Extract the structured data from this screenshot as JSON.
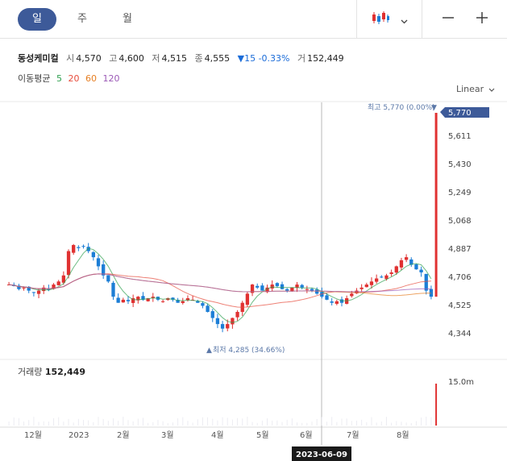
{
  "toolbar": {
    "tabs": [
      "일",
      "주",
      "월"
    ],
    "active_tab": "일"
  },
  "stock": {
    "name": "동성케미컬",
    "open_label": "시",
    "open": "4,570",
    "high_label": "고",
    "high": "4,600",
    "low_label": "저",
    "low": "4,515",
    "close_label": "종",
    "close": "4,555",
    "change_arrow": "▼",
    "change": "15",
    "change_pct": "-0.33%",
    "volume_label": "거",
    "volume": "152,449"
  },
  "moving_average": {
    "title": "이동평균",
    "periods": [
      "5",
      "20",
      "60",
      "120"
    ]
  },
  "scale": {
    "label": "Linear"
  },
  "annotations": {
    "high": "최고 5,770 (0.00%)",
    "low": "최저 4,285 (34.66%)"
  },
  "price_axis": {
    "current": "5,770",
    "ticks": [
      "5,611",
      "5,430",
      "5,249",
      "5,068",
      "4,887",
      "4,706",
      "4,525",
      "4,344"
    ]
  },
  "volume_panel": {
    "label": "거래량",
    "value": "152,449",
    "axis_label": "15.0m"
  },
  "date_axis": {
    "labels": [
      "12월",
      "2023",
      "2월",
      "3월",
      "4월",
      "5월",
      "6월",
      "7월",
      "8월"
    ],
    "crosshair_date": "2023-06-09"
  },
  "colors": {
    "up": "#e03131",
    "down": "#1c7ed6",
    "accent": "#3d5a99",
    "ma5": "#2e9f4f",
    "ma20": "#e74c3c",
    "ma60": "#e67e22",
    "ma120": "#9b59b6"
  },
  "chart_data": {
    "type": "candlestick",
    "y_range": [
      4285,
      5770
    ],
    "high": 5770,
    "low": 4285,
    "close_series": [
      4640,
      4630,
      4610,
      4620,
      4600,
      4590,
      4600,
      4620,
      4610,
      4640,
      4660,
      4700,
      4860,
      4900,
      4880,
      4890,
      4860,
      4820,
      4760,
      4700,
      4660,
      4560,
      4520,
      4540,
      4530,
      4550,
      4560,
      4540,
      4550,
      4560,
      4540,
      4530,
      4550,
      4540,
      4520,
      4530,
      4550,
      4540,
      4520,
      4500,
      4460,
      4420,
      4380,
      4350,
      4380,
      4420,
      4460,
      4520,
      4580,
      4640,
      4620,
      4600,
      4620,
      4640,
      4630,
      4610,
      4600,
      4620,
      4640,
      4620,
      4610,
      4600,
      4580,
      4560,
      4540,
      4520,
      4530,
      4520,
      4550,
      4580,
      4600,
      4620,
      4640,
      4660,
      4680,
      4690,
      4700,
      4720,
      4760,
      4800,
      4820,
      4770,
      4740,
      4720,
      4600,
      4560
    ]
  }
}
